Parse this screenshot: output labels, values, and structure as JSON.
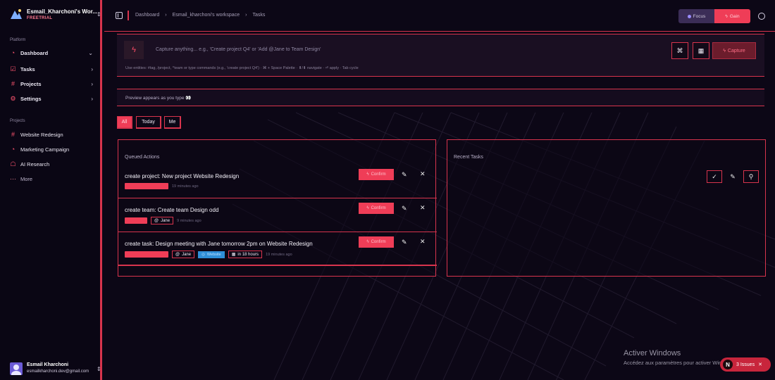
{
  "sidebar": {
    "workspace_name": "Esmail_Kharchoni's Wor...",
    "plan": "FREETRIAL",
    "platform_label": "Platform",
    "items": [
      {
        "label": "Dashboard",
        "icon": "dashboard-icon"
      },
      {
        "label": "Tasks",
        "icon": "tasks-icon"
      },
      {
        "label": "Projects",
        "icon": "projects-icon"
      },
      {
        "label": "Settings",
        "icon": "settings-icon"
      }
    ],
    "projects_label": "Projects",
    "projects": [
      {
        "label": "Website Redesign",
        "icon": "hash-icon"
      },
      {
        "label": "Marketing Campaign",
        "icon": "chart-icon"
      },
      {
        "label": "AI Research",
        "icon": "robot-icon"
      },
      {
        "label": "More",
        "icon": "more-icon"
      }
    ],
    "user_name": "Esmail Kharchoni",
    "user_email": "esmailkharchoni.dev@gmail.com"
  },
  "topbar": {
    "breadcrumbs": [
      "Dashboard",
      "Esmail_kharchoni's workspace",
      "Tasks"
    ],
    "focus_label": "Focus",
    "gain_label": "Gain"
  },
  "capture": {
    "placeholder": "Capture anything... e.g., 'Create project Q4' or 'Add @Jane to Team Design'",
    "submit_label": "Capture",
    "hint": "Use entities: #tag, /project, ^team or type commands (e.g., 'create project Q4') · ⌘ + Space Palette · ⬆/⬇ navigate · ⏎ apply · Tab cycle"
  },
  "preview": {
    "text": "Preview appears as you type 👀"
  },
  "filters": [
    {
      "label": "All"
    },
    {
      "label": "Today"
    },
    {
      "label": "Me"
    }
  ],
  "queued": {
    "title": "Queued Actions",
    "confirm_label": "Confirm",
    "items": [
      {
        "text": "create project: New project Website Redesign",
        "time": "19 minutes ago",
        "assignee": "",
        "project": "",
        "due": ""
      },
      {
        "text": "create team: Create team Design odd",
        "time": "9 minutes ago",
        "assignee": "Jane",
        "project": "",
        "due": ""
      },
      {
        "text": "create task: Design meeting with Jane tomorrow 2pm on Website Redesign",
        "time": "19 minutes ago",
        "assignee": "Jane",
        "project": "Website",
        "due": "in 18 hours"
      }
    ]
  },
  "recent": {
    "title": "Recent Tasks"
  },
  "windows": {
    "line1": "Activer Windows",
    "line2": "Accédez aux paramètres pour activer Windows."
  },
  "issues": {
    "label": "3 Issues"
  },
  "colors": {
    "accent": "#ef3d57",
    "border": "#d8344d",
    "background": "#0c0716",
    "blue": "#2f8fd8"
  }
}
